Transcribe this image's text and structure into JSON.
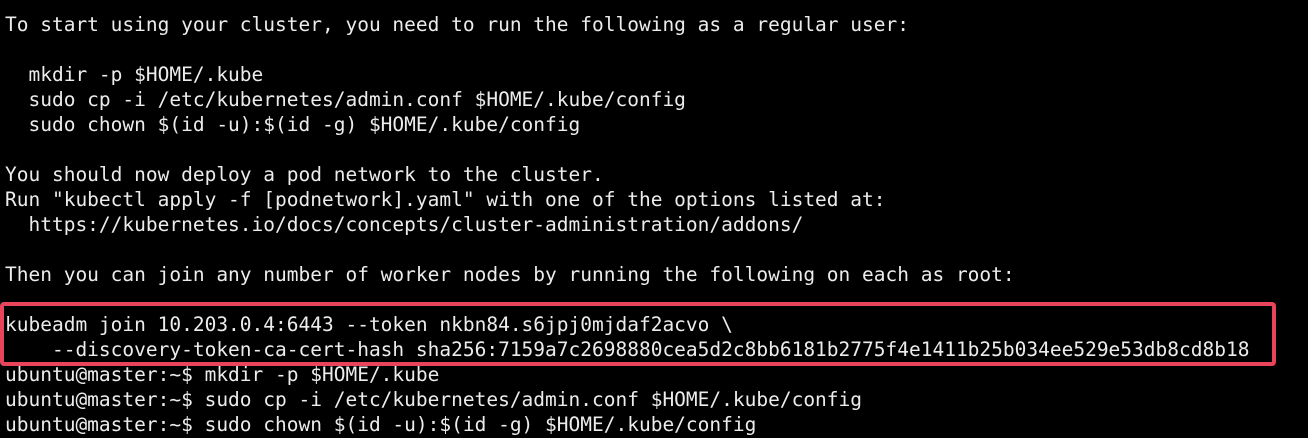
{
  "terminal": {
    "background": "#000000",
    "foreground": "#ececec",
    "highlight_color": "#e8455d",
    "output": {
      "intro": "To start using your cluster, you need to run the following as a regular user:",
      "cmd_mkdir": "  mkdir -p $HOME/.kube",
      "cmd_cp": "  sudo cp -i /etc/kubernetes/admin.conf $HOME/.kube/config",
      "cmd_chown": "  sudo chown $(id -u):$(id -g) $HOME/.kube/config",
      "deploy_msg": "You should now deploy a pod network to the cluster.",
      "run_msg": "Run \"kubectl apply -f [podnetwork].yaml\" with one of the options listed at:",
      "addons_url": "  https://kubernetes.io/docs/concepts/cluster-administration/addons/",
      "join_msg": "Then you can join any number of worker nodes by running the following on each as root:",
      "join_cmd": "kubeadm join 10.203.0.4:6443 --token nkbn84.s6jpj0mjdaf2acvo \\",
      "join_hash": "    --discovery-token-ca-cert-hash sha256:7159a7c2698880cea5d2c8bb6181b2775f4e1411b25b034ee529e53db8cd8b18"
    },
    "prompts": [
      {
        "text": "ubuntu@master:~$ mkdir -p $HOME/.kube"
      },
      {
        "text": "ubuntu@master:~$ sudo cp -i /etc/kubernetes/admin.conf $HOME/.kube/config"
      },
      {
        "text": "ubuntu@master:~$ sudo chown $(id -u):$(id -g) $HOME/.kube/config"
      }
    ]
  }
}
